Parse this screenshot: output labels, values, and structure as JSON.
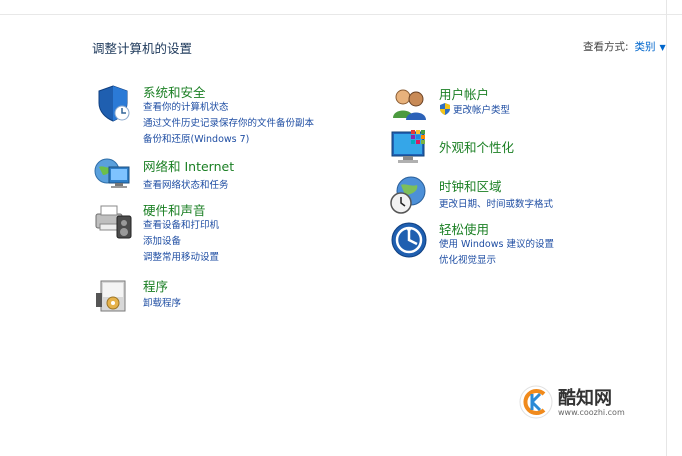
{
  "header": {
    "title": "调整计算机的设置",
    "view_by_label": "查看方式:",
    "view_by_value": "类别"
  },
  "left": [
    {
      "title": "系统和安全",
      "links": [
        "查看你的计算机状态",
        "通过文件历史记录保存你的文件备份副本",
        "备份和还原(Windows 7)"
      ]
    },
    {
      "title": "网络和 Internet",
      "links": [
        "查看网络状态和任务"
      ]
    },
    {
      "title": "硬件和声音",
      "links": [
        "查看设备和打印机",
        "添加设备",
        "调整常用移动设置"
      ]
    },
    {
      "title": "程序",
      "links": [
        "卸载程序"
      ]
    }
  ],
  "right": [
    {
      "title": "用户帐户",
      "links": [
        "更改帐户类型"
      ]
    },
    {
      "title": "外观和个性化",
      "links": []
    },
    {
      "title": "时钟和区域",
      "links": [
        "更改日期、时间或数字格式"
      ]
    },
    {
      "title": "轻松使用",
      "links": [
        "使用 Windows 建议的设置",
        "优化视觉显示"
      ]
    }
  ],
  "watermark": {
    "name": "酷知网",
    "url": "www.coozhi.com"
  },
  "colors": {
    "category_title": "#1a7f23",
    "link": "#1f4ea3",
    "title": "#1e395b"
  }
}
